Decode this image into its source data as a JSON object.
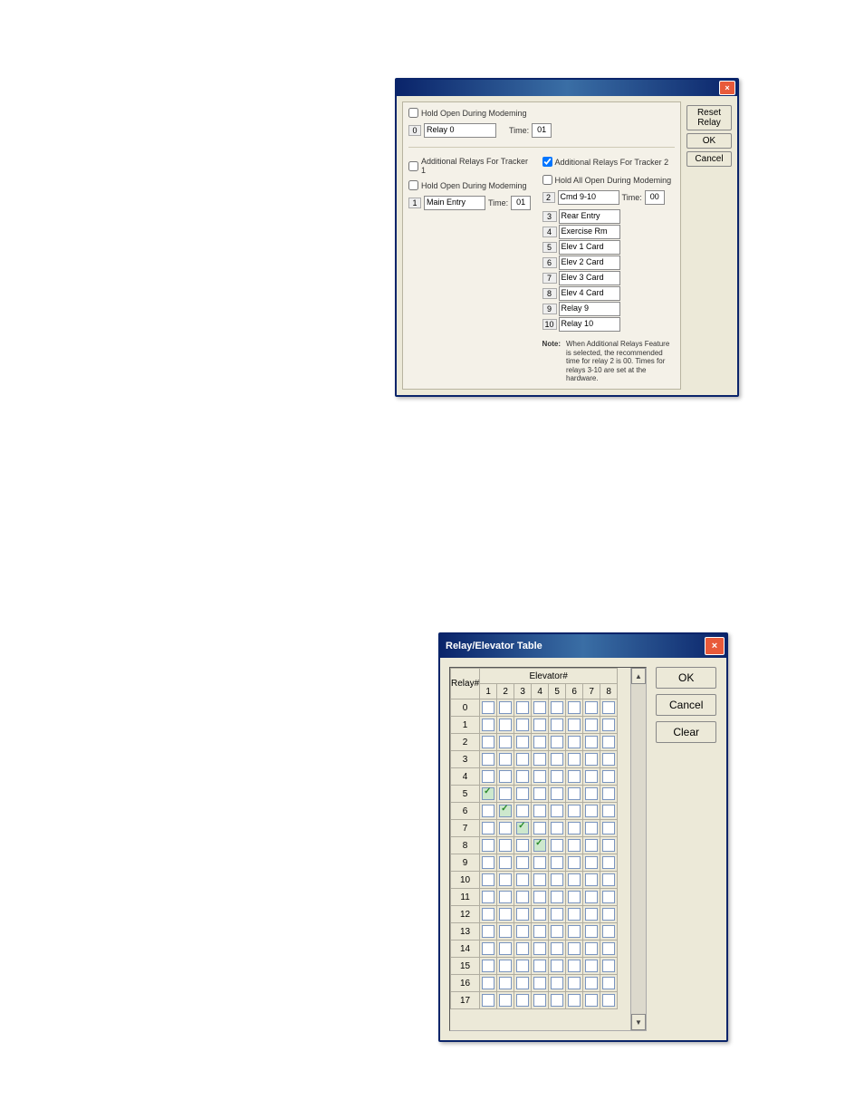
{
  "dlg1": {
    "title": "",
    "buttons": {
      "reset": "Reset Relay",
      "ok": "OK",
      "cancel": "Cancel"
    },
    "hold_open_top": "Hold Open During Modeming",
    "relay0_num": "0",
    "relay0_name": "Relay 0",
    "time_lbl": "Time:",
    "time0": "01",
    "addl1": "Additional Relays For Tracker 1",
    "addl2": "Additional Relays For Tracker 2",
    "hold_open_l": "Hold Open During Modeming",
    "hold_all_r": "Hold All Open During Modeming",
    "left_num": "1",
    "left_name": "Main Entry",
    "left_time": "01",
    "right_num": "2",
    "right_name": "Cmd 9-10",
    "right_time": "00",
    "rows": [
      {
        "n": "3",
        "t": "Rear Entry"
      },
      {
        "n": "4",
        "t": "Exercise Rm"
      },
      {
        "n": "5",
        "t": "Elev 1 Card"
      },
      {
        "n": "6",
        "t": "Elev 2 Card"
      },
      {
        "n": "7",
        "t": "Elev 3 Card"
      },
      {
        "n": "8",
        "t": "Elev 4 Card"
      },
      {
        "n": "9",
        "t": "Relay 9"
      },
      {
        "n": "10",
        "t": "Relay 10"
      }
    ],
    "note_lbl": "Note:",
    "note_txt": "When Additional Relays Feature is selected, the recommended time for relay 2 is 00. Times for relays 3-10 are set at the hardware."
  },
  "dlg2": {
    "title": "Relay/Elevator Table",
    "buttons": {
      "ok": "OK",
      "cancel": "Cancel",
      "clear": "Clear"
    },
    "relay_hdr": "Relay#",
    "elev_hdr": "Elevator#",
    "cols": [
      "1",
      "2",
      "3",
      "4",
      "5",
      "6",
      "7",
      "8"
    ],
    "rows": [
      "0",
      "1",
      "2",
      "3",
      "4",
      "5",
      "6",
      "7",
      "8",
      "9",
      "10",
      "11",
      "12",
      "13",
      "14",
      "15",
      "16",
      "17"
    ],
    "checked": [
      [
        5,
        0
      ],
      [
        6,
        1
      ],
      [
        7,
        2
      ],
      [
        8,
        3
      ]
    ]
  }
}
